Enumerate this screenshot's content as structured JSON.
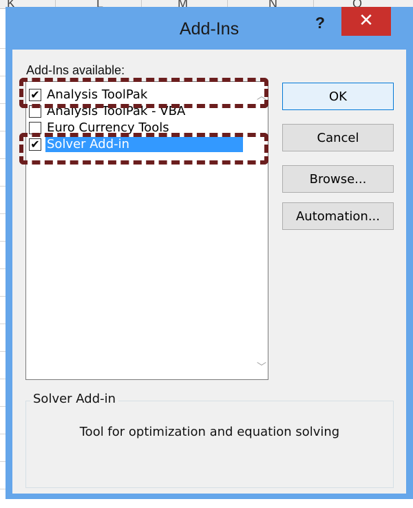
{
  "sheet": {
    "columns": [
      "K",
      "L",
      "M",
      "N",
      "O"
    ]
  },
  "dialog": {
    "title": "Add-Ins",
    "help_label": "?",
    "close_label": "✕",
    "available_label": "Add-Ins available:",
    "addins": [
      {
        "label": "Analysis ToolPak",
        "checked": true,
        "selected": false,
        "check_mark": "✔"
      },
      {
        "label": "Analysis ToolPak - VBA",
        "checked": false,
        "selected": false,
        "check_mark": ""
      },
      {
        "label": "Euro Currency Tools",
        "checked": false,
        "selected": false,
        "check_mark": ""
      },
      {
        "label": "Solver Add-in",
        "checked": true,
        "selected": true,
        "check_mark": "✔"
      }
    ],
    "scroll_up_icon": "︿",
    "scroll_down_icon": "﹀",
    "buttons": {
      "ok": "OK",
      "cancel": "Cancel",
      "browse": "Browse...",
      "automation": "Automation..."
    },
    "description_group_title": "Solver Add-in",
    "description_text": "Tool for optimization and equation solving"
  },
  "colors": {
    "title_bar": "#65a6ea",
    "close_button": "#c9302c",
    "selection": "#3399ff",
    "highlight_dash": "#6b1e1e"
  }
}
